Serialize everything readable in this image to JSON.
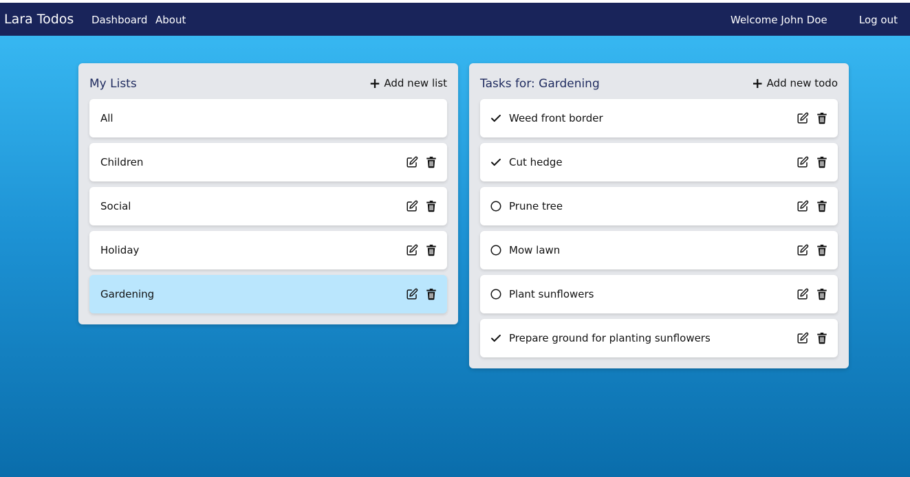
{
  "header": {
    "brand": "Lara Todos",
    "nav": {
      "dashboard": "Dashboard",
      "about": "About"
    },
    "welcome": "Welcome John Doe",
    "logout": "Log out"
  },
  "lists_panel": {
    "title": "My Lists",
    "add_label": "Add new list",
    "items": [
      {
        "label": "All",
        "editable": false,
        "selected": false
      },
      {
        "label": "Children",
        "editable": true,
        "selected": false
      },
      {
        "label": "Social",
        "editable": true,
        "selected": false
      },
      {
        "label": "Holiday",
        "editable": true,
        "selected": false
      },
      {
        "label": "Gardening",
        "editable": true,
        "selected": true
      }
    ]
  },
  "tasks_panel": {
    "title": "Tasks for: Gardening",
    "add_label": "Add new todo",
    "items": [
      {
        "label": "Weed front border",
        "done": true
      },
      {
        "label": "Cut hedge",
        "done": true
      },
      {
        "label": "Prune tree",
        "done": false
      },
      {
        "label": "Mow lawn",
        "done": false
      },
      {
        "label": "Plant sunflowers",
        "done": false
      },
      {
        "label": "Prepare ground for planting sunflowers",
        "done": true
      }
    ]
  },
  "colors": {
    "navbar": "#19245a",
    "panel": "#e5e7eb",
    "selected_row": "#bae6fd",
    "title_text": "#1e2a5e"
  },
  "icons": {
    "edit": "edit-icon",
    "delete": "trash-icon",
    "done": "check-icon",
    "pending": "circle-icon",
    "add": "plus-icon"
  }
}
